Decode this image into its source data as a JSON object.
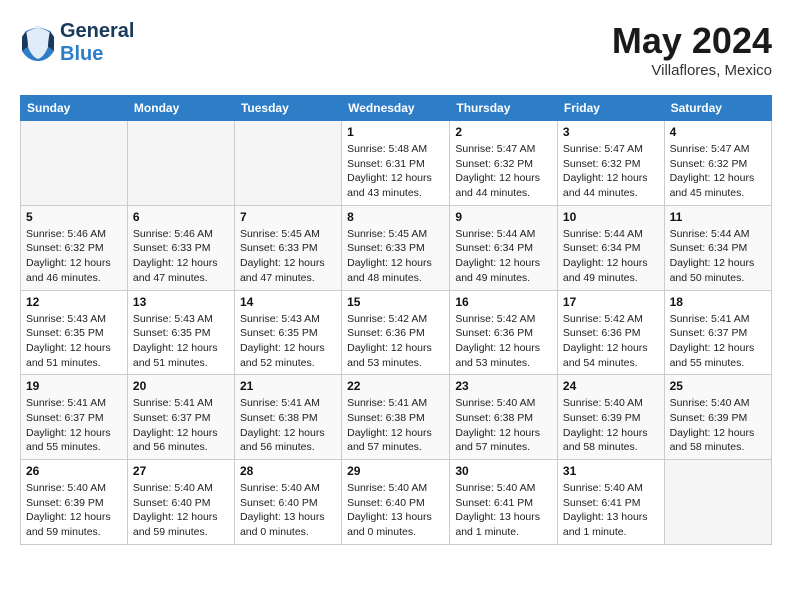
{
  "header": {
    "logo_general": "General",
    "logo_blue": "Blue",
    "month_year": "May 2024",
    "location": "Villaflores, Mexico"
  },
  "calendar": {
    "weekdays": [
      "Sunday",
      "Monday",
      "Tuesday",
      "Wednesday",
      "Thursday",
      "Friday",
      "Saturday"
    ],
    "weeks": [
      [
        {
          "day": "",
          "info": ""
        },
        {
          "day": "",
          "info": ""
        },
        {
          "day": "",
          "info": ""
        },
        {
          "day": "1",
          "info": "Sunrise: 5:48 AM\nSunset: 6:31 PM\nDaylight: 12 hours and 43 minutes."
        },
        {
          "day": "2",
          "info": "Sunrise: 5:47 AM\nSunset: 6:32 PM\nDaylight: 12 hours and 44 minutes."
        },
        {
          "day": "3",
          "info": "Sunrise: 5:47 AM\nSunset: 6:32 PM\nDaylight: 12 hours and 44 minutes."
        },
        {
          "day": "4",
          "info": "Sunrise: 5:47 AM\nSunset: 6:32 PM\nDaylight: 12 hours and 45 minutes."
        }
      ],
      [
        {
          "day": "5",
          "info": "Sunrise: 5:46 AM\nSunset: 6:32 PM\nDaylight: 12 hours and 46 minutes."
        },
        {
          "day": "6",
          "info": "Sunrise: 5:46 AM\nSunset: 6:33 PM\nDaylight: 12 hours and 47 minutes."
        },
        {
          "day": "7",
          "info": "Sunrise: 5:45 AM\nSunset: 6:33 PM\nDaylight: 12 hours and 47 minutes."
        },
        {
          "day": "8",
          "info": "Sunrise: 5:45 AM\nSunset: 6:33 PM\nDaylight: 12 hours and 48 minutes."
        },
        {
          "day": "9",
          "info": "Sunrise: 5:44 AM\nSunset: 6:34 PM\nDaylight: 12 hours and 49 minutes."
        },
        {
          "day": "10",
          "info": "Sunrise: 5:44 AM\nSunset: 6:34 PM\nDaylight: 12 hours and 49 minutes."
        },
        {
          "day": "11",
          "info": "Sunrise: 5:44 AM\nSunset: 6:34 PM\nDaylight: 12 hours and 50 minutes."
        }
      ],
      [
        {
          "day": "12",
          "info": "Sunrise: 5:43 AM\nSunset: 6:35 PM\nDaylight: 12 hours and 51 minutes."
        },
        {
          "day": "13",
          "info": "Sunrise: 5:43 AM\nSunset: 6:35 PM\nDaylight: 12 hours and 51 minutes."
        },
        {
          "day": "14",
          "info": "Sunrise: 5:43 AM\nSunset: 6:35 PM\nDaylight: 12 hours and 52 minutes."
        },
        {
          "day": "15",
          "info": "Sunrise: 5:42 AM\nSunset: 6:36 PM\nDaylight: 12 hours and 53 minutes."
        },
        {
          "day": "16",
          "info": "Sunrise: 5:42 AM\nSunset: 6:36 PM\nDaylight: 12 hours and 53 minutes."
        },
        {
          "day": "17",
          "info": "Sunrise: 5:42 AM\nSunset: 6:36 PM\nDaylight: 12 hours and 54 minutes."
        },
        {
          "day": "18",
          "info": "Sunrise: 5:41 AM\nSunset: 6:37 PM\nDaylight: 12 hours and 55 minutes."
        }
      ],
      [
        {
          "day": "19",
          "info": "Sunrise: 5:41 AM\nSunset: 6:37 PM\nDaylight: 12 hours and 55 minutes."
        },
        {
          "day": "20",
          "info": "Sunrise: 5:41 AM\nSunset: 6:37 PM\nDaylight: 12 hours and 56 minutes."
        },
        {
          "day": "21",
          "info": "Sunrise: 5:41 AM\nSunset: 6:38 PM\nDaylight: 12 hours and 56 minutes."
        },
        {
          "day": "22",
          "info": "Sunrise: 5:41 AM\nSunset: 6:38 PM\nDaylight: 12 hours and 57 minutes."
        },
        {
          "day": "23",
          "info": "Sunrise: 5:40 AM\nSunset: 6:38 PM\nDaylight: 12 hours and 57 minutes."
        },
        {
          "day": "24",
          "info": "Sunrise: 5:40 AM\nSunset: 6:39 PM\nDaylight: 12 hours and 58 minutes."
        },
        {
          "day": "25",
          "info": "Sunrise: 5:40 AM\nSunset: 6:39 PM\nDaylight: 12 hours and 58 minutes."
        }
      ],
      [
        {
          "day": "26",
          "info": "Sunrise: 5:40 AM\nSunset: 6:39 PM\nDaylight: 12 hours and 59 minutes."
        },
        {
          "day": "27",
          "info": "Sunrise: 5:40 AM\nSunset: 6:40 PM\nDaylight: 12 hours and 59 minutes."
        },
        {
          "day": "28",
          "info": "Sunrise: 5:40 AM\nSunset: 6:40 PM\nDaylight: 13 hours and 0 minutes."
        },
        {
          "day": "29",
          "info": "Sunrise: 5:40 AM\nSunset: 6:40 PM\nDaylight: 13 hours and 0 minutes."
        },
        {
          "day": "30",
          "info": "Sunrise: 5:40 AM\nSunset: 6:41 PM\nDaylight: 13 hours and 1 minute."
        },
        {
          "day": "31",
          "info": "Sunrise: 5:40 AM\nSunset: 6:41 PM\nDaylight: 13 hours and 1 minute."
        },
        {
          "day": "",
          "info": ""
        }
      ]
    ]
  }
}
